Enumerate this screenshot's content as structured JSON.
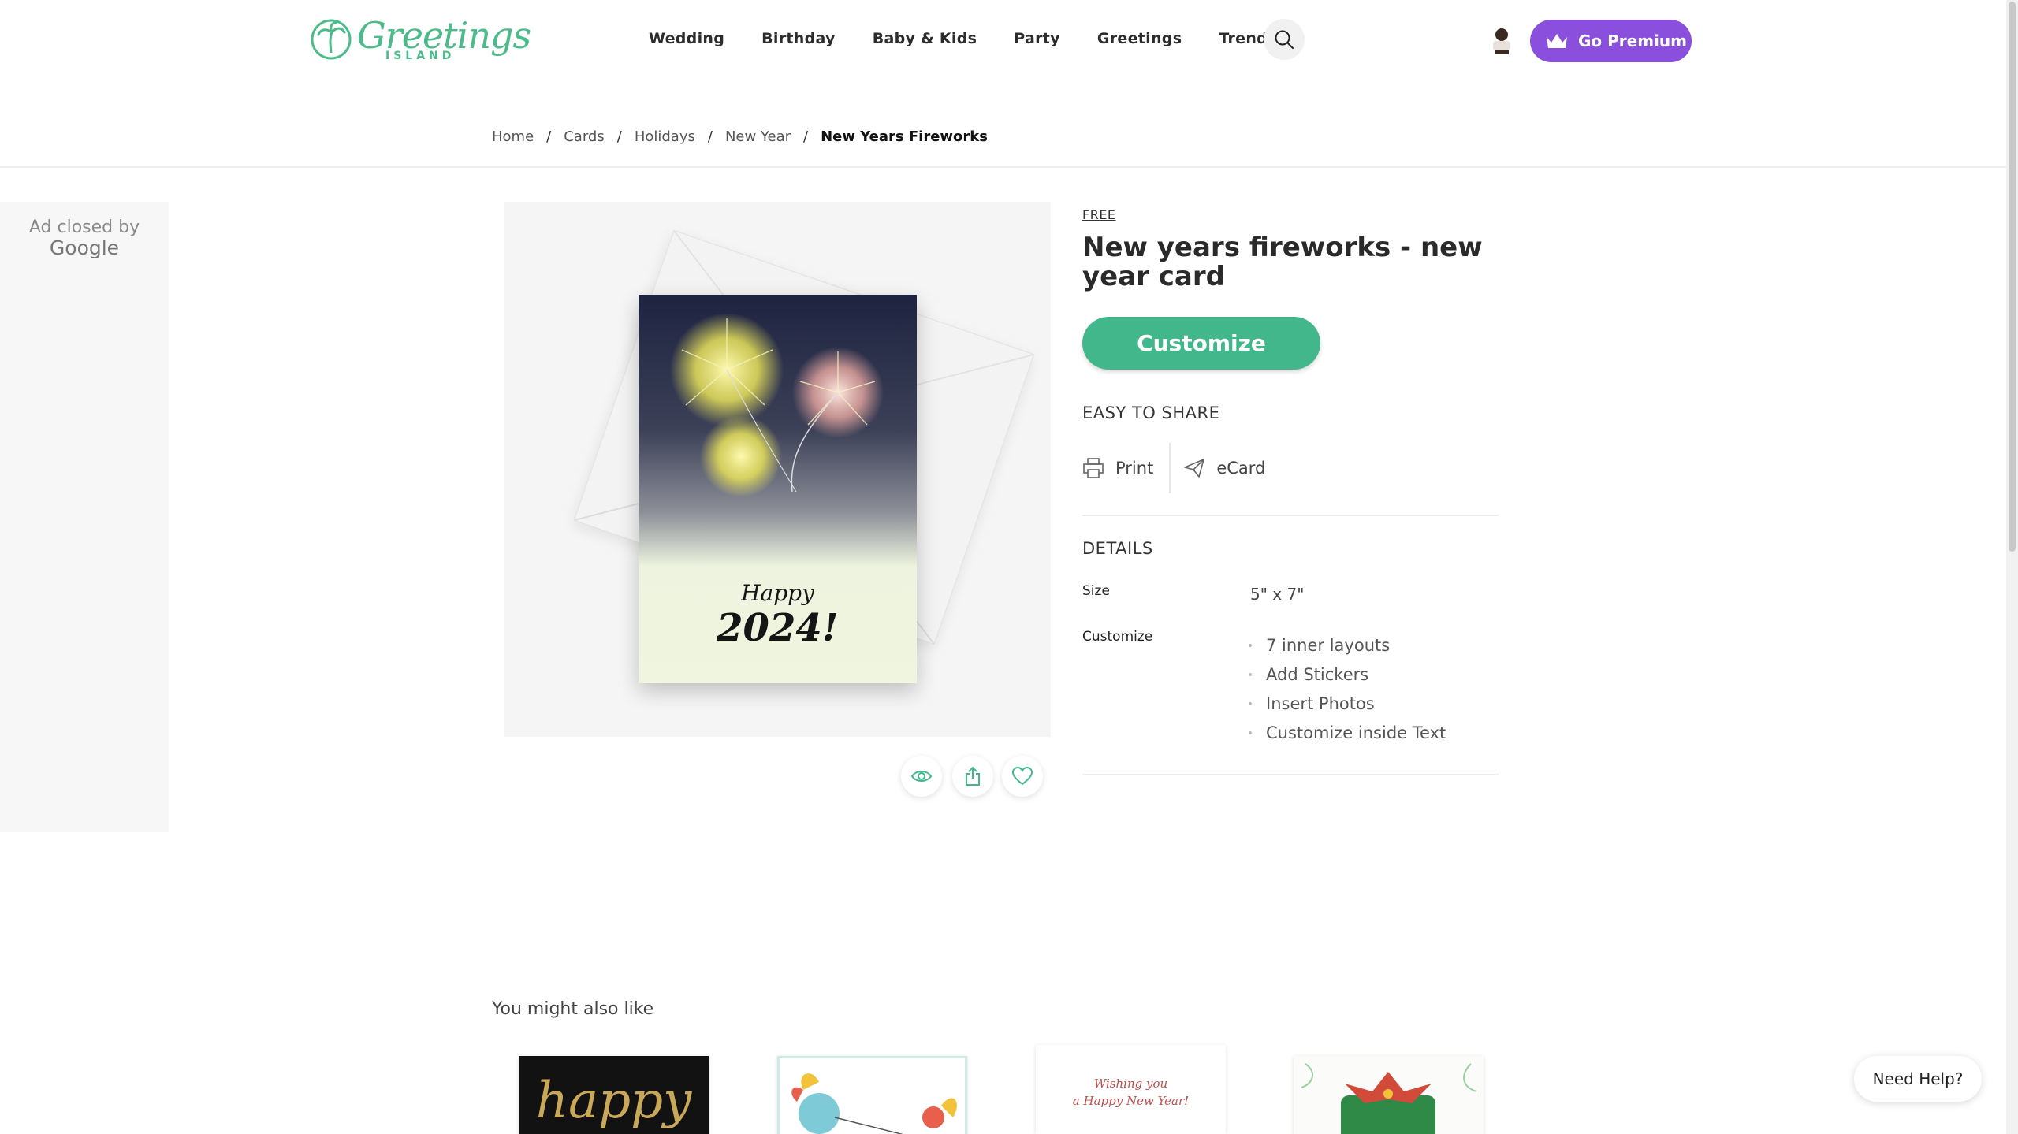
{
  "header": {
    "logo_text": "Greetings",
    "logo_subtext": "ISLAND",
    "nav": [
      "Wedding",
      "Birthday",
      "Baby & Kids",
      "Party",
      "Greetings",
      "Trending"
    ],
    "premium_label": "Go Premium"
  },
  "breadcrumb": [
    "Home",
    "Cards",
    "Holidays",
    "New Year",
    "New Years Fireworks"
  ],
  "ad": {
    "line1": "Ad closed by",
    "line2": "Google"
  },
  "card": {
    "happy": "Happy",
    "year": "2024!"
  },
  "product": {
    "price_label": "FREE",
    "title": "New years fireworks - new year card",
    "customize_label": "Customize",
    "share_heading": "EASY TO SHARE",
    "share_options": [
      "Print",
      "eCard"
    ],
    "details_heading": "DETAILS",
    "size_label": "Size",
    "size_value": "5\" x 7\"",
    "customize_label_small": "Customize",
    "features": [
      "7 inner layouts",
      "Add Stickers",
      "Insert Photos",
      "Customize inside Text"
    ]
  },
  "related": {
    "heading": "You might also like",
    "thumb_texts": [
      "happy",
      "Wishing you",
      "a Happy New Year!"
    ]
  },
  "help_label": "Need Help?",
  "colors": {
    "brand_green": "#43b78c",
    "premium_purple": "#8a4fdc"
  },
  "icons": [
    "search-icon",
    "crown-icon",
    "printer-icon",
    "paper-plane-icon",
    "eye-icon",
    "share-icon",
    "heart-icon"
  ]
}
